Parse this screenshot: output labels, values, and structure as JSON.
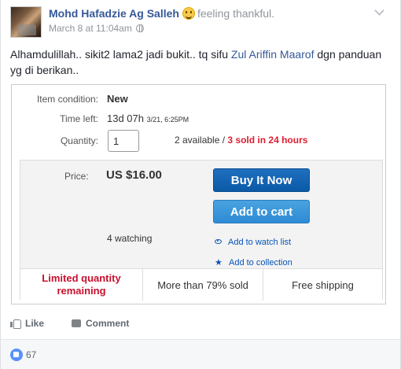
{
  "post": {
    "author": "Mohd Hafadzie Ag Salleh",
    "feeling": "feeling thankful.",
    "date": "March 8 at 11:04am",
    "text_before": "Alhamdulillah.. sikit2 lama2 jadi bukit.. tq sifu ",
    "mention": "Zul Ariffin Maarof",
    "text_after": " dgn panduan yg di berikan.."
  },
  "listing": {
    "condition_label": "Item condition:",
    "condition_value": "New",
    "time_left_label": "Time left:",
    "time_left_value": "13d 07h",
    "time_left_detail": "3/21, 6:25PM",
    "quantity_label": "Quantity:",
    "quantity_value": "1",
    "available": "2 available / ",
    "sold_24h": "3 sold in 24 hours",
    "price_label": "Price:",
    "price": "US $16.00",
    "watching": "4 watching",
    "buy_now": "Buy It Now",
    "add_to_cart": "Add to cart",
    "watch_list": "Add to watch list",
    "collection": "Add to collection",
    "badge_limited": "Limited quantity remaining",
    "badge_sold": "More than 79% sold",
    "badge_shipping": "Free shipping"
  },
  "actions": {
    "like": "Like",
    "comment": "Comment"
  },
  "footer": {
    "reaction_count": "67"
  }
}
